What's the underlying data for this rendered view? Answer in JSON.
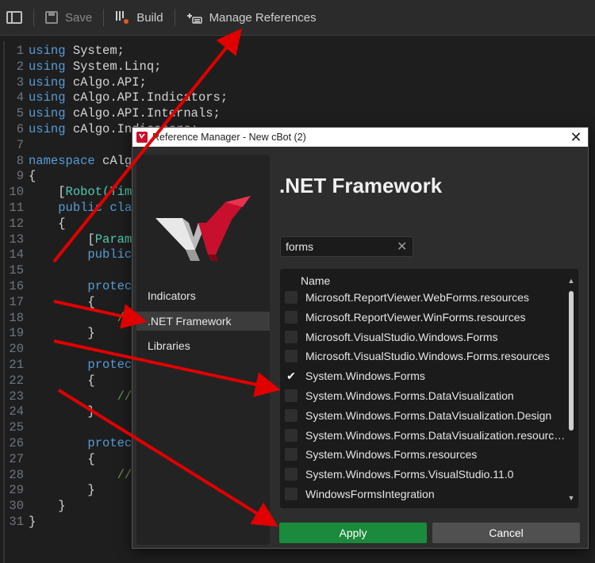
{
  "toolbar": {
    "save_label": "Save",
    "build_label": "Build",
    "manage_refs_label": "Manage References"
  },
  "editor": {
    "lines": [
      {
        "n": "1",
        "tokens": [
          [
            "kw",
            "using"
          ],
          [
            "t",
            " System;"
          ]
        ]
      },
      {
        "n": "2",
        "tokens": [
          [
            "kw",
            "using"
          ],
          [
            "t",
            " System.Linq;"
          ]
        ]
      },
      {
        "n": "3",
        "tokens": [
          [
            "kw",
            "using"
          ],
          [
            "t",
            " cAlgo.API;"
          ]
        ]
      },
      {
        "n": "4",
        "tokens": [
          [
            "kw",
            "using"
          ],
          [
            "t",
            " cAlgo.API.Indicators;"
          ]
        ]
      },
      {
        "n": "5",
        "tokens": [
          [
            "kw",
            "using"
          ],
          [
            "t",
            " cAlgo.API.Internals;"
          ]
        ]
      },
      {
        "n": "6",
        "tokens": [
          [
            "kw",
            "using"
          ],
          [
            "t",
            " cAlgo.Indicators;"
          ]
        ]
      },
      {
        "n": "7",
        "tokens": []
      },
      {
        "n": "8",
        "tokens": [
          [
            "kw",
            "namespace"
          ],
          [
            "t",
            " cAlgo"
          ]
        ]
      },
      {
        "n": "9",
        "tokens": [
          [
            "t",
            "{"
          ]
        ]
      },
      {
        "n": "10",
        "tokens": [
          [
            "t",
            "    ["
          ],
          [
            "at",
            "Robot(Time"
          ]
        ]
      },
      {
        "n": "11",
        "tokens": [
          [
            "t",
            "    "
          ],
          [
            "kw",
            "public"
          ],
          [
            "t",
            " "
          ],
          [
            "kw",
            "cla"
          ]
        ]
      },
      {
        "n": "12",
        "tokens": [
          [
            "t",
            "    {"
          ]
        ]
      },
      {
        "n": "13",
        "tokens": [
          [
            "t",
            "        ["
          ],
          [
            "at",
            "Parame"
          ]
        ]
      },
      {
        "n": "14",
        "tokens": [
          [
            "t",
            "        "
          ],
          [
            "kw",
            "public"
          ]
        ]
      },
      {
        "n": "15",
        "tokens": []
      },
      {
        "n": "16",
        "tokens": [
          [
            "t",
            "        "
          ],
          [
            "kw",
            "protect"
          ]
        ]
      },
      {
        "n": "17",
        "tokens": [
          [
            "t",
            "        {"
          ]
        ]
      },
      {
        "n": "18",
        "tokens": [
          [
            "t",
            "            "
          ],
          [
            "cm",
            "//"
          ]
        ]
      },
      {
        "n": "19",
        "tokens": [
          [
            "t",
            "        }"
          ]
        ]
      },
      {
        "n": "20",
        "tokens": []
      },
      {
        "n": "21",
        "tokens": [
          [
            "t",
            "        "
          ],
          [
            "kw",
            "protect"
          ]
        ]
      },
      {
        "n": "22",
        "tokens": [
          [
            "t",
            "        {"
          ]
        ]
      },
      {
        "n": "23",
        "tokens": [
          [
            "t",
            "            "
          ],
          [
            "cm",
            "//"
          ]
        ]
      },
      {
        "n": "24",
        "tokens": [
          [
            "t",
            "        }"
          ]
        ]
      },
      {
        "n": "25",
        "tokens": []
      },
      {
        "n": "26",
        "tokens": [
          [
            "t",
            "        "
          ],
          [
            "kw",
            "protect"
          ]
        ]
      },
      {
        "n": "27",
        "tokens": [
          [
            "t",
            "        {"
          ]
        ]
      },
      {
        "n": "28",
        "tokens": [
          [
            "t",
            "            "
          ],
          [
            "cm",
            "//"
          ]
        ]
      },
      {
        "n": "29",
        "tokens": [
          [
            "t",
            "        }"
          ]
        ]
      },
      {
        "n": "30",
        "tokens": [
          [
            "t",
            "    }"
          ]
        ]
      },
      {
        "n": "31",
        "tokens": [
          [
            "t",
            "}"
          ]
        ]
      }
    ]
  },
  "dialog": {
    "title": "Reference Manager - New cBot (2)",
    "close_glyph": "✕",
    "heading": ".NET Framework",
    "nav": [
      {
        "label": "Indicators",
        "selected": false
      },
      {
        "label": ".NET Framework",
        "selected": true
      },
      {
        "label": "Libraries",
        "selected": false
      }
    ],
    "search": {
      "value": "forms",
      "clear_glyph": "✕"
    },
    "list_header": "Name",
    "items": [
      {
        "label": "Microsoft.ReportViewer.WebForms.resources",
        "checked": false
      },
      {
        "label": "Microsoft.ReportViewer.WinForms.resources",
        "checked": false
      },
      {
        "label": "Microsoft.VisualStudio.Windows.Forms",
        "checked": false
      },
      {
        "label": "Microsoft.VisualStudio.Windows.Forms.resources",
        "checked": false
      },
      {
        "label": "System.Windows.Forms",
        "checked": true
      },
      {
        "label": "System.Windows.Forms.DataVisualization",
        "checked": false
      },
      {
        "label": "System.Windows.Forms.DataVisualization.Design",
        "checked": false
      },
      {
        "label": "System.Windows.Forms.DataVisualization.resources",
        "checked": false
      },
      {
        "label": "System.Windows.Forms.resources",
        "checked": false
      },
      {
        "label": "System.Windows.Forms.VisualStudio.11.0",
        "checked": false
      },
      {
        "label": "WindowsFormsIntegration",
        "checked": false
      }
    ],
    "apply_label": "Apply",
    "cancel_label": "Cancel"
  },
  "colors": {
    "accent_arrow": "#e00000",
    "apply_green": "#1a8a3c",
    "logo_red": "#c8102e"
  }
}
